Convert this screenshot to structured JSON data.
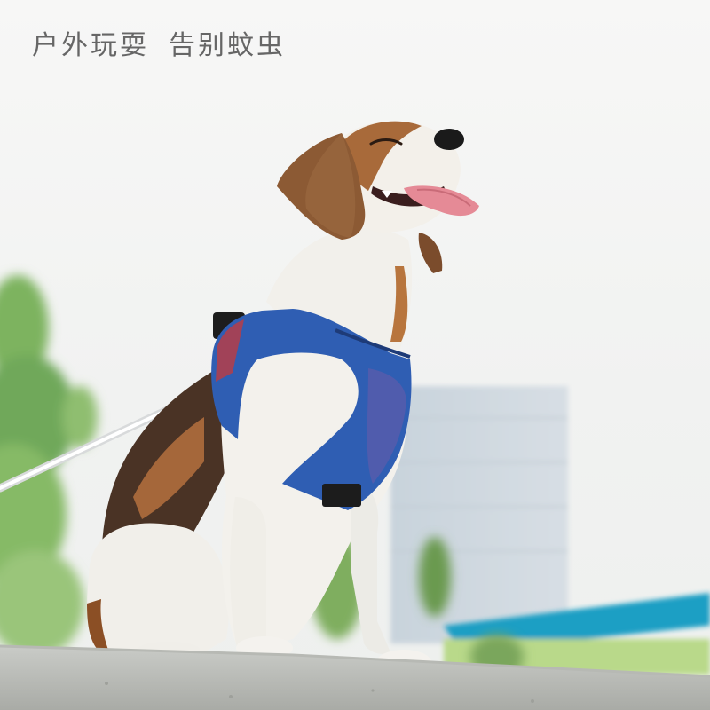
{
  "caption": {
    "part1": "户外玩耍",
    "part2": "告别蚊虫"
  },
  "colors": {
    "harness_blue": "#2f5eb3",
    "tongue_pink": "#e58a96",
    "foliage_green": "#6fa85a",
    "sky_white": "#f4f5f4"
  },
  "illustration": {
    "subject": "beagle-wearing-blue-harness",
    "icons": [
      "leash",
      "harness-buckle"
    ]
  }
}
